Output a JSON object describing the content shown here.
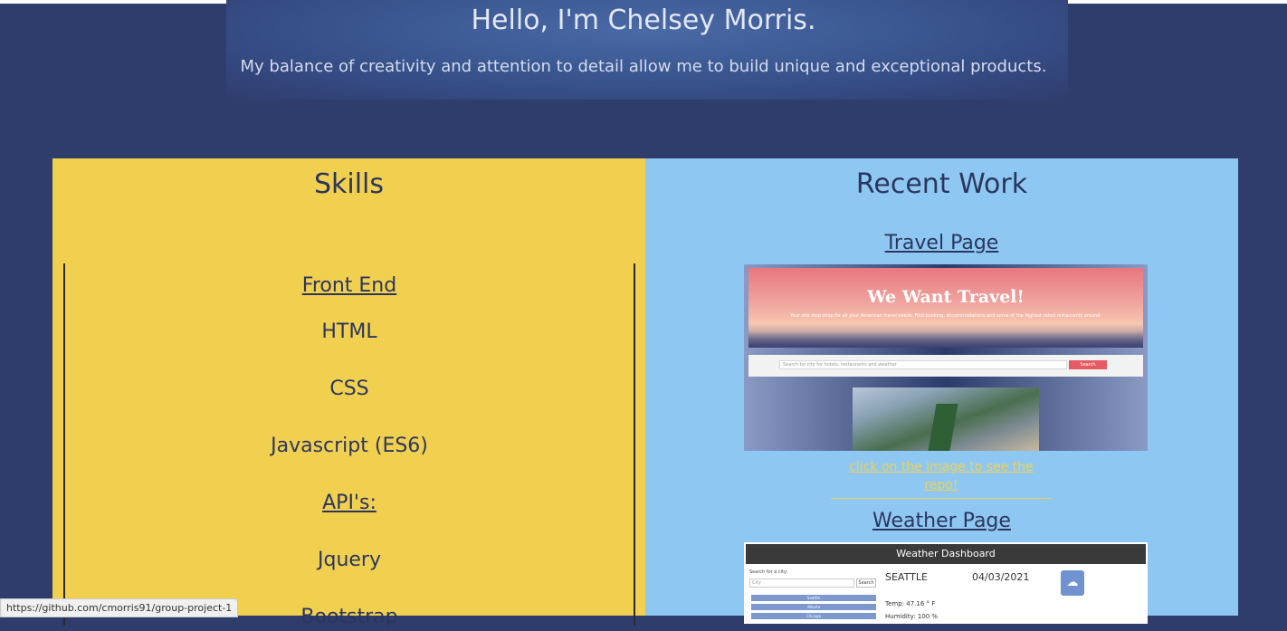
{
  "hero": {
    "title": "Hello, I'm Chelsey Morris.",
    "subtitle": "My balance of creativity and attention to detail allow me to build unique and exceptional products."
  },
  "skills": {
    "title": "Skills",
    "front_end_heading": "Front End",
    "front_end_items": [
      "HTML",
      "CSS",
      "Javascript (ES6)"
    ],
    "api_heading": "API's:",
    "api_items": [
      "Jquery",
      "Bootstrap"
    ]
  },
  "work": {
    "title": "Recent Work",
    "projects": [
      {
        "link": "Travel Page",
        "screenshot": {
          "title": "We Want Travel!",
          "tagline": "Your one stop shop for all your American travel needs. Find booking, accommodations and some of the highest rated restaurants around.",
          "search_placeholder": "Search by city for hotels, restaurants and weather",
          "search_button": "Search"
        }
      },
      {
        "link": "Weather Page",
        "screenshot": {
          "header": "Weather Dashboard",
          "side_label": "Search for a city:",
          "input_placeholder": "City",
          "search_button": "Search",
          "city_buttons": [
            "Seattle",
            "Atlanta",
            "Chicago"
          ],
          "city": "SEATTLE",
          "date": "04/03/2021",
          "temp": "Temp: 47.16 ° F",
          "humidity": "Humidity: 100 %",
          "weather_icon": "cloud-icon"
        }
      }
    ],
    "repo_note": "click on the image to see the repo!"
  },
  "status_bar": {
    "url": "https://github.com/cmorris91/group-project-1"
  },
  "colors": {
    "background": "#2f3d6d",
    "skills_panel": "#f2d04f",
    "work_panel": "#8ec8f2",
    "heading_text": "#2b365e",
    "accent": "#f2d04f"
  }
}
